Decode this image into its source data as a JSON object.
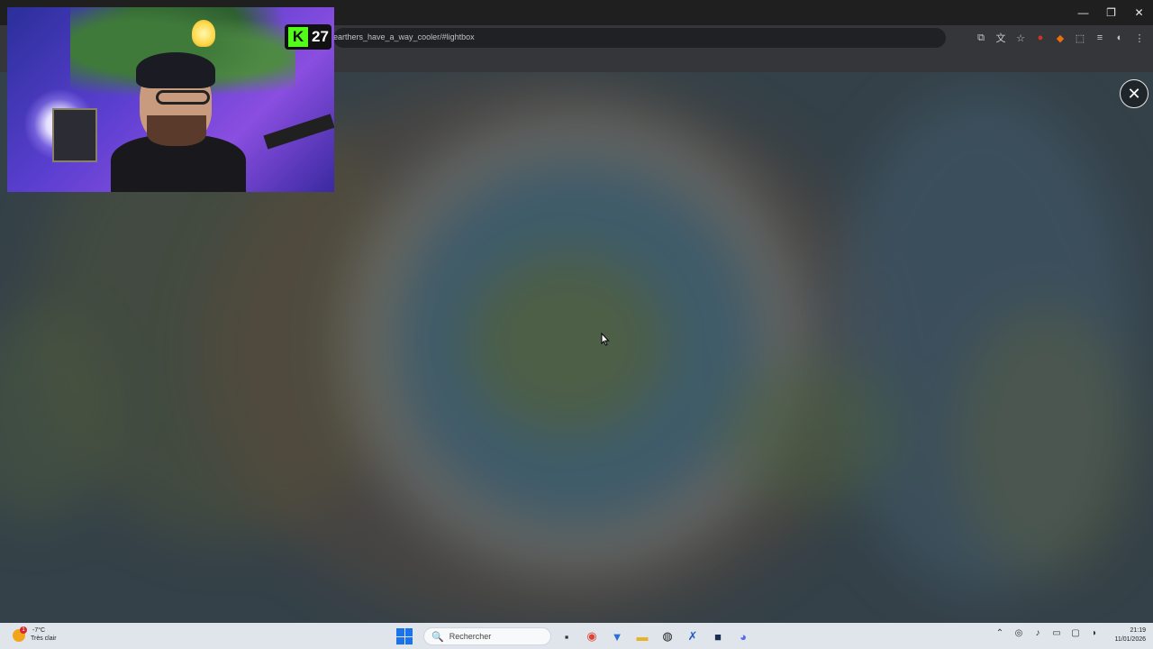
{
  "browser": {
    "url": "earthers_have_a_way_cooler/#lightbox",
    "window_controls": {
      "minimize": "—",
      "restore": "❐",
      "close": "✕"
    },
    "toolbar_icons": [
      "install-app-icon",
      "translate-icon",
      "bookmark-star-icon",
      "extension-red-icon",
      "extension-orange-icon",
      "extensions-puzzle-icon",
      "media-controls-icon",
      "profile-icon",
      "menu-dots-icon"
    ]
  },
  "lightbox": {
    "close_label": "✕",
    "image_palette": [
      "#5a7a7e",
      "#3d6a8a",
      "#6a7a3a",
      "#7a5a3a",
      "#a7a9a0"
    ]
  },
  "webcam": {
    "badge_logo": "K",
    "badge_count": "27"
  },
  "taskbar": {
    "weather_temp": "-7°C",
    "weather_condition": "Très clair",
    "weather_alert": "1",
    "search_placeholder": "Rechercher",
    "search_icon": "🔍",
    "time": "21:19",
    "date": "11/01/2026",
    "apps": [
      "task-view-icon",
      "chrome-icon",
      "vpn-icon",
      "file-explorer-icon",
      "obs-icon",
      "kick-icon",
      "photoshop-icon",
      "discord-icon"
    ],
    "tray_icons": [
      "chevron-up-icon",
      "steam-icon",
      "mic-icon",
      "keyboard-icon",
      "display-icon",
      "volume-icon"
    ]
  }
}
